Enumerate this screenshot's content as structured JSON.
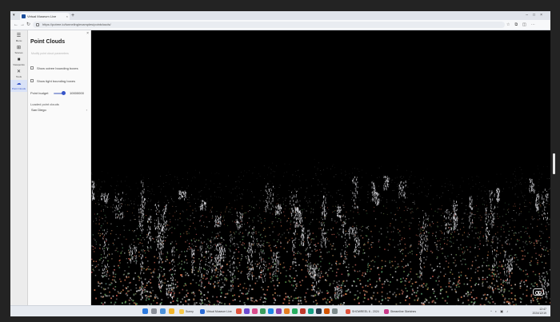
{
  "browser": {
    "tab_title": "Virtual Museum Live",
    "url": "https://potree.io/tunneling/examples/pointclouds/",
    "new_tab_symbol": "+",
    "tab_close_symbol": "×"
  },
  "rail": {
    "items": [
      {
        "label": "Menu",
        "icon": "hamburger-icon",
        "glyph": "☰"
      },
      {
        "label": "Scenes",
        "icon": "scene-icon",
        "glyph": "⊞"
      },
      {
        "label": "Viewpoints",
        "icon": "camera-icon",
        "glyph": "■"
      },
      {
        "label": "Tools",
        "icon": "tools-icon",
        "glyph": "✕"
      },
      {
        "label": "Point Clouds",
        "icon": "cloud-icon",
        "glyph": "☁"
      }
    ]
  },
  "panel": {
    "title": "Point Clouds",
    "close_symbol": "×",
    "hint": "Modify point cloud parameters",
    "show_octree_label": "Show octree bounding boxes",
    "show_tight_label": "Show tight bounding boxes",
    "point_budget_label": "Point budget",
    "point_budget_value": "10000000",
    "point_budget_fraction": 0.8,
    "loaded_label": "Loaded point clouds",
    "cloud_name": "San Diego",
    "cloud_chevron": "›"
  },
  "taskbar": {
    "apps": [
      {
        "label": "Virtual Museum Live",
        "color": "#2a6bd6"
      },
      {
        "label": "SHOWREEL 6 - 2024",
        "color": "#e0533d"
      },
      {
        "label": "Streamline Sketches",
        "color": "#c93a8a"
      }
    ],
    "weather": "Sunny",
    "time": "12:47",
    "date": "2024/12/19"
  },
  "colors": {
    "accent": "#3655c9",
    "rail_active": "#d9e2f7",
    "viewport_bg": "#000000"
  }
}
